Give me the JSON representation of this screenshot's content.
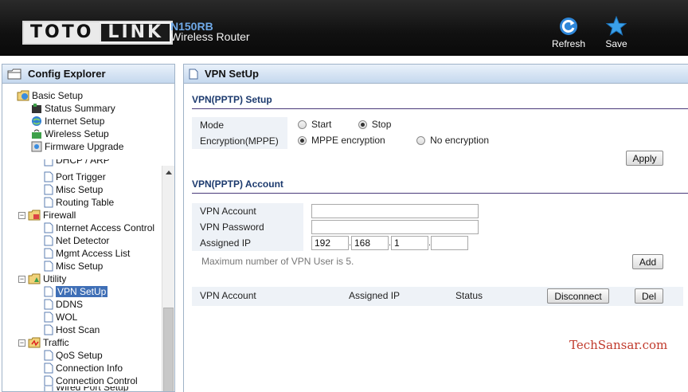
{
  "header": {
    "logo_left": "TOTO",
    "logo_right": "LINK",
    "model": "N150RB",
    "subtitle": "Wireless Router",
    "refresh_label": "Refresh",
    "save_label": "Save"
  },
  "sidebar": {
    "title": "Config Explorer",
    "tree": [
      {
        "label": "Basic Setup",
        "icon": "globe-folder-icon",
        "expander": ""
      },
      {
        "label": "Status Summary",
        "icon": "status-icon"
      },
      {
        "label": "Internet Setup",
        "icon": "internet-icon"
      },
      {
        "label": "Wireless Setup",
        "icon": "wireless-icon"
      },
      {
        "label": "Firmware Upgrade",
        "icon": "firmware-icon"
      },
      {
        "label": "DHCP / ARP",
        "icon": "page-icon",
        "partial": true
      },
      {
        "label": "Port Trigger",
        "icon": "page-icon"
      },
      {
        "label": "Misc Setup",
        "icon": "page-icon"
      },
      {
        "label": "Routing Table",
        "icon": "page-icon"
      },
      {
        "label": "Firewall",
        "icon": "firewall-folder-icon",
        "expander": "-"
      },
      {
        "label": "Internet Access Control",
        "icon": "page-icon"
      },
      {
        "label": "Net Detector",
        "icon": "page-icon"
      },
      {
        "label": "Mgmt Access List",
        "icon": "page-icon"
      },
      {
        "label": "Misc Setup",
        "icon": "page-icon"
      },
      {
        "label": "Utility",
        "icon": "utility-folder-icon",
        "expander": "-"
      },
      {
        "label": "VPN SetUp",
        "icon": "page-icon",
        "selected": true
      },
      {
        "label": "DDNS",
        "icon": "page-icon"
      },
      {
        "label": "WOL",
        "icon": "page-icon"
      },
      {
        "label": "Host Scan",
        "icon": "page-icon"
      },
      {
        "label": "Traffic",
        "icon": "traffic-folder-icon",
        "expander": "-"
      },
      {
        "label": "QoS Setup",
        "icon": "page-icon"
      },
      {
        "label": "Connection Info",
        "icon": "page-icon"
      },
      {
        "label": "Connection Control",
        "icon": "page-icon"
      },
      {
        "label": "Wired Port Setup",
        "icon": "page-icon",
        "partial": true
      }
    ]
  },
  "main": {
    "title": "VPN SetUp",
    "setup": {
      "section_title": "VPN(PPTP) Setup",
      "mode_label": "Mode",
      "mode_start": "Start",
      "mode_stop": "Stop",
      "encryption_label": "Encryption(MPPE)",
      "enc_mppe": "MPPE encryption",
      "enc_none": "No encryption",
      "apply_label": "Apply"
    },
    "account": {
      "section_title": "VPN(PPTP) Account",
      "account_label": "VPN Account",
      "account_value": "",
      "password_label": "VPN Password",
      "password_value": "",
      "ip_label": "Assigned IP",
      "ip_octets": [
        "192",
        "168",
        "1",
        ""
      ],
      "hint": "Maximum number of VPN User is 5.",
      "add_label": "Add"
    },
    "list": {
      "col_account": "VPN Account",
      "col_ip": "Assigned IP",
      "col_status": "Status",
      "disconnect_label": "Disconnect",
      "del_label": "Del"
    }
  },
  "watermark": "TechSansar.com",
  "colors": {
    "header_bg": "#111111",
    "model_blue": "#6fa9e8",
    "panel_title_bg": "#c5d8ee",
    "section_title": "#1c3a6e",
    "selected_bg": "#3f6fb6",
    "watermark": "#c0392b"
  }
}
